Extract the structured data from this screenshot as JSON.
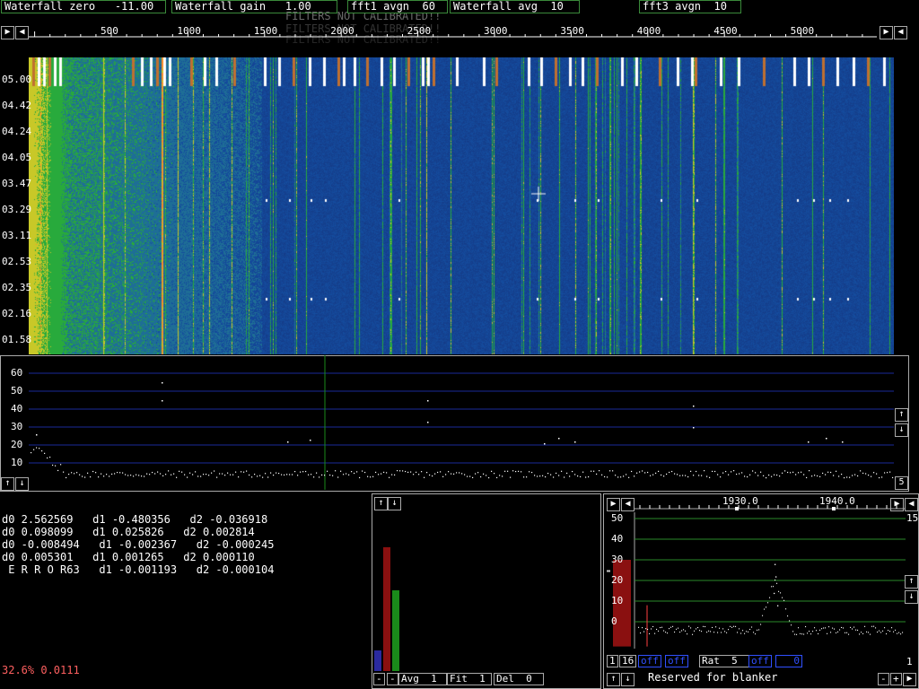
{
  "top_bar": {
    "waterfall_zero": "Waterfall zero   -11.00",
    "waterfall_gain": "Waterfall gain   1.00",
    "fft1_avgn": "fft1 avgn  60",
    "waterfall_avg": "Waterfall avg  10",
    "fft3_avgn": "fft3 avgn  10",
    "ghost_line1": "FILTERS NOT CALIBRATED!!",
    "ghost_line2": "FILTERS NOT CALIBRATED!!",
    "ghost_line3": "FILTERS NOT CALIBRATED!!"
  },
  "freq_axis": {
    "ticks": [
      "500",
      "1000",
      "1500",
      "2000",
      "2500",
      "3000",
      "3500",
      "4000",
      "4500",
      "5000"
    ]
  },
  "waterfall": {
    "time_labels": [
      "05.00",
      "04.42",
      "04.24",
      "04.05",
      "03.47",
      "03.29",
      "03.11",
      "02.53",
      "02.35",
      "02.16",
      "01.58"
    ]
  },
  "spectrum": {
    "y_ticks": [
      "60",
      "50",
      "40",
      "30",
      "20",
      "10"
    ],
    "right_value": "5"
  },
  "coefficients": {
    "lines": [
      "d0 2.562569   d1 -0.480356   d2 -0.036918",
      "d0 0.098099   d1 0.025826   d2 0.002814",
      "d0 -0.008494   d1 -0.002367   d2 -0.000245",
      "d0 0.005301   d1 0.001265   d2 0.000110",
      " E R R O R63   d1 -0.001193   d2 -0.000104"
    ],
    "status": "32.6% 0.0111"
  },
  "bars_panel": {
    "avg": "Avg  1",
    "fit": "Fit  1",
    "del": "Del  0",
    "bars": [
      {
        "color": "#2a2aa0",
        "level": 0.09
      },
      {
        "color": "#8a1010",
        "level": 0.55
      },
      {
        "color": "#1a8a1a",
        "level": 0.36
      }
    ]
  },
  "zoom_panel": {
    "freq_ticks": [
      "1930.0",
      "1940.0"
    ],
    "y_ticks": [
      "50",
      "40",
      "30",
      "20",
      "10",
      "0"
    ],
    "right_top": "15",
    "right_bottom": "1",
    "btn_1": "1",
    "btn_16": "16",
    "btn_off1": "off",
    "btn_off2": "off",
    "rat": "Rat  5",
    "btn_off3": "off",
    "btn_0": "0",
    "blanker": "Reserved for blanker",
    "minus": "-",
    "plus": "+"
  },
  "colors": {
    "panel_border": "#3a8a3a",
    "grid_blue": "#1a2a9a",
    "grid_green": "#2a8a2a",
    "error_text": "#ff6060"
  }
}
